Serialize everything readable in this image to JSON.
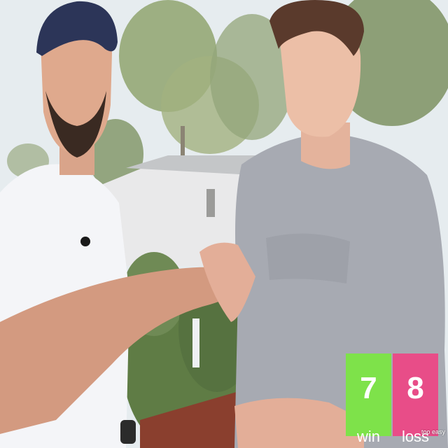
{
  "scoreboard": {
    "win": {
      "value": "7",
      "label": "win",
      "color": "#7ee24a"
    },
    "loss": {
      "value": "8",
      "label": "loss",
      "color": "#e84d88"
    }
  },
  "watermark": "too easy",
  "scene": {
    "sky_color": "#e6ecef",
    "foliage_color": "#6f8a55",
    "left_shirt_color": "#f4f5f8",
    "right_shirt_color": "#a7aab2",
    "cap_color": "#2c3558"
  }
}
